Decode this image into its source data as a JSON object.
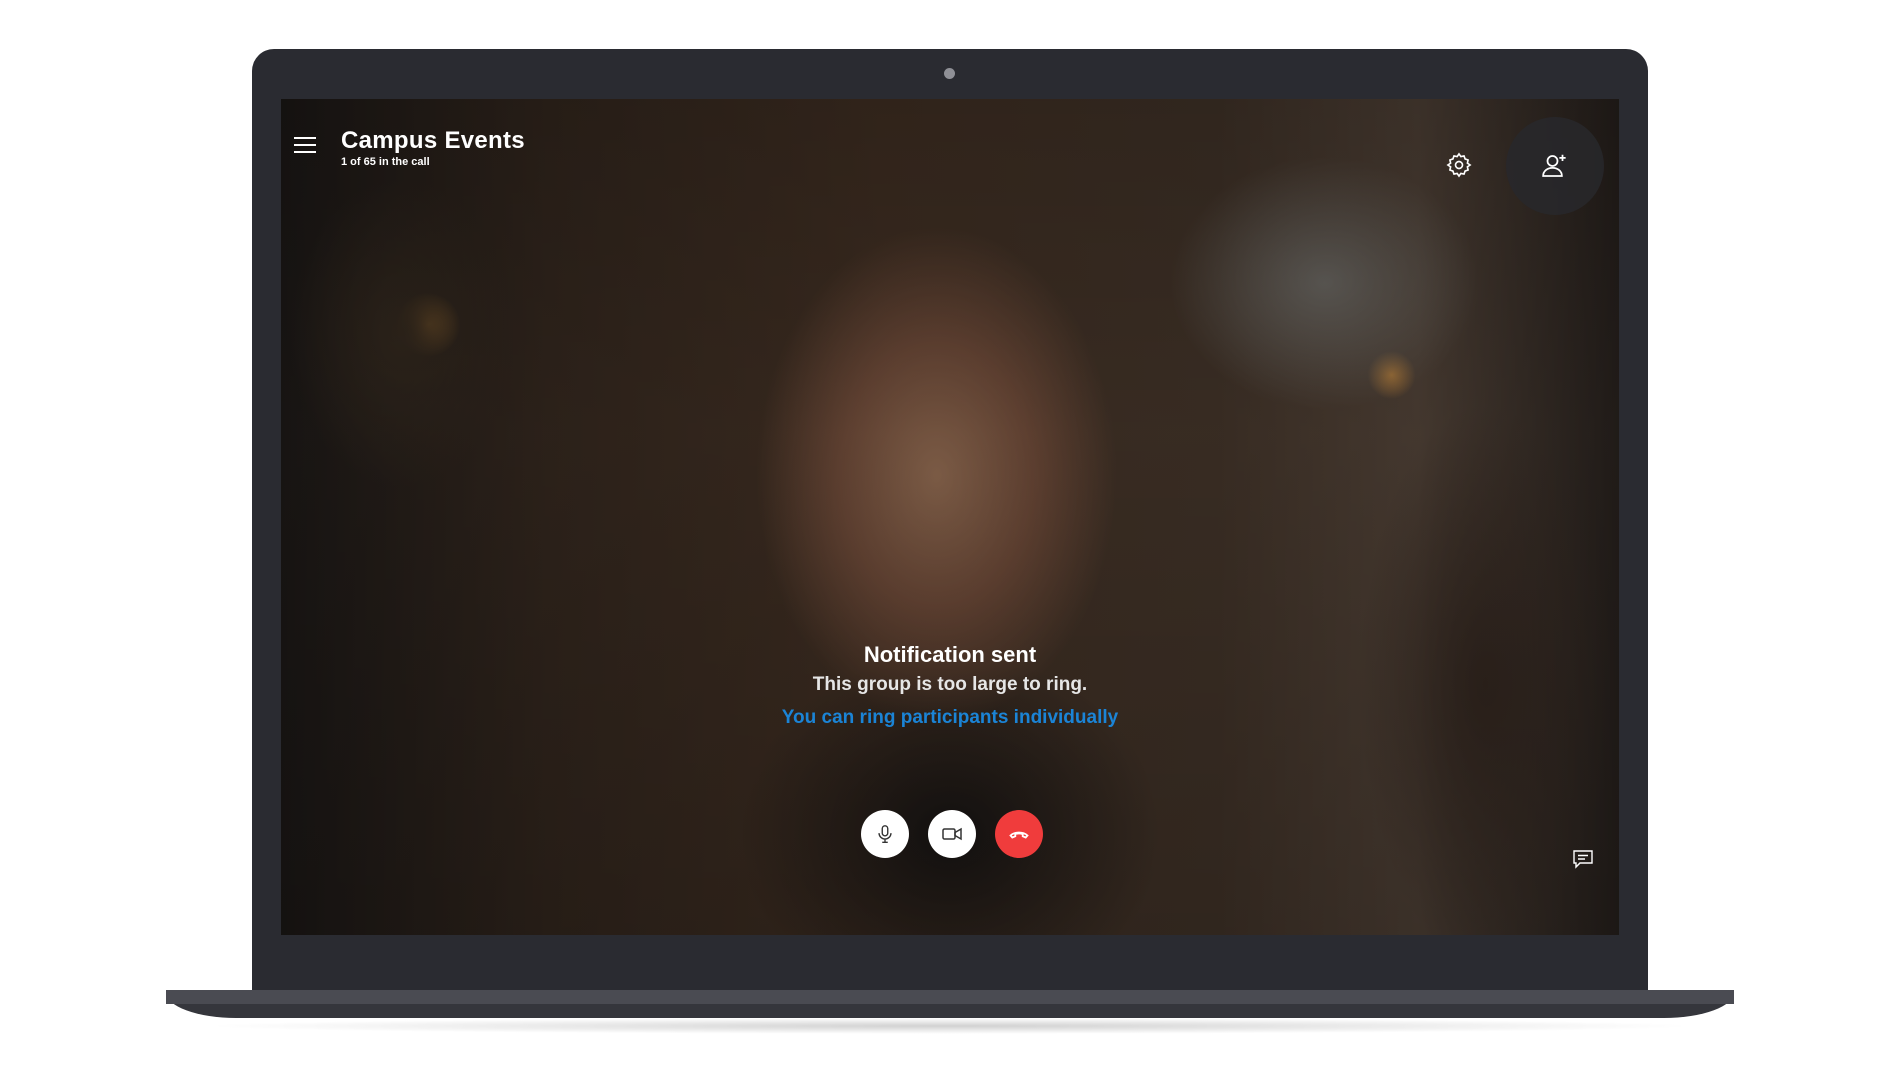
{
  "call": {
    "title": "Campus Events",
    "subtitle": "1 of 65 in the call"
  },
  "notification": {
    "title": "Notification sent",
    "body": "This group is too large to ring.",
    "link": "You can ring participants individually"
  },
  "icons": {
    "menu": "hamburger-menu-icon",
    "settings": "gear-icon",
    "add_participant": "add-person-icon",
    "mic": "microphone-icon",
    "camera": "video-camera-icon",
    "end_call": "hang-up-icon",
    "chat": "chat-bubble-icon"
  },
  "colors": {
    "link": "#1b84d6",
    "end_call": "#f03c3c",
    "device_frame": "#2a2b31"
  }
}
